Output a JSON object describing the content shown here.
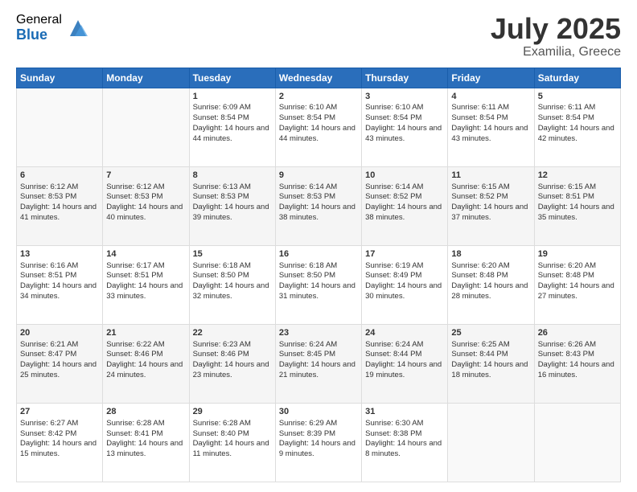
{
  "header": {
    "logo_general": "General",
    "logo_blue": "Blue",
    "month_title": "July 2025",
    "location": "Examilia, Greece"
  },
  "weekdays": [
    "Sunday",
    "Monday",
    "Tuesday",
    "Wednesday",
    "Thursday",
    "Friday",
    "Saturday"
  ],
  "weeks": [
    [
      {
        "day": "",
        "sunrise": "",
        "sunset": "",
        "daylight": ""
      },
      {
        "day": "",
        "sunrise": "",
        "sunset": "",
        "daylight": ""
      },
      {
        "day": "1",
        "sunrise": "Sunrise: 6:09 AM",
        "sunset": "Sunset: 8:54 PM",
        "daylight": "Daylight: 14 hours and 44 minutes."
      },
      {
        "day": "2",
        "sunrise": "Sunrise: 6:10 AM",
        "sunset": "Sunset: 8:54 PM",
        "daylight": "Daylight: 14 hours and 44 minutes."
      },
      {
        "day": "3",
        "sunrise": "Sunrise: 6:10 AM",
        "sunset": "Sunset: 8:54 PM",
        "daylight": "Daylight: 14 hours and 43 minutes."
      },
      {
        "day": "4",
        "sunrise": "Sunrise: 6:11 AM",
        "sunset": "Sunset: 8:54 PM",
        "daylight": "Daylight: 14 hours and 43 minutes."
      },
      {
        "day": "5",
        "sunrise": "Sunrise: 6:11 AM",
        "sunset": "Sunset: 8:54 PM",
        "daylight": "Daylight: 14 hours and 42 minutes."
      }
    ],
    [
      {
        "day": "6",
        "sunrise": "Sunrise: 6:12 AM",
        "sunset": "Sunset: 8:53 PM",
        "daylight": "Daylight: 14 hours and 41 minutes."
      },
      {
        "day": "7",
        "sunrise": "Sunrise: 6:12 AM",
        "sunset": "Sunset: 8:53 PM",
        "daylight": "Daylight: 14 hours and 40 minutes."
      },
      {
        "day": "8",
        "sunrise": "Sunrise: 6:13 AM",
        "sunset": "Sunset: 8:53 PM",
        "daylight": "Daylight: 14 hours and 39 minutes."
      },
      {
        "day": "9",
        "sunrise": "Sunrise: 6:14 AM",
        "sunset": "Sunset: 8:53 PM",
        "daylight": "Daylight: 14 hours and 38 minutes."
      },
      {
        "day": "10",
        "sunrise": "Sunrise: 6:14 AM",
        "sunset": "Sunset: 8:52 PM",
        "daylight": "Daylight: 14 hours and 38 minutes."
      },
      {
        "day": "11",
        "sunrise": "Sunrise: 6:15 AM",
        "sunset": "Sunset: 8:52 PM",
        "daylight": "Daylight: 14 hours and 37 minutes."
      },
      {
        "day": "12",
        "sunrise": "Sunrise: 6:15 AM",
        "sunset": "Sunset: 8:51 PM",
        "daylight": "Daylight: 14 hours and 35 minutes."
      }
    ],
    [
      {
        "day": "13",
        "sunrise": "Sunrise: 6:16 AM",
        "sunset": "Sunset: 8:51 PM",
        "daylight": "Daylight: 14 hours and 34 minutes."
      },
      {
        "day": "14",
        "sunrise": "Sunrise: 6:17 AM",
        "sunset": "Sunset: 8:51 PM",
        "daylight": "Daylight: 14 hours and 33 minutes."
      },
      {
        "day": "15",
        "sunrise": "Sunrise: 6:18 AM",
        "sunset": "Sunset: 8:50 PM",
        "daylight": "Daylight: 14 hours and 32 minutes."
      },
      {
        "day": "16",
        "sunrise": "Sunrise: 6:18 AM",
        "sunset": "Sunset: 8:50 PM",
        "daylight": "Daylight: 14 hours and 31 minutes."
      },
      {
        "day": "17",
        "sunrise": "Sunrise: 6:19 AM",
        "sunset": "Sunset: 8:49 PM",
        "daylight": "Daylight: 14 hours and 30 minutes."
      },
      {
        "day": "18",
        "sunrise": "Sunrise: 6:20 AM",
        "sunset": "Sunset: 8:48 PM",
        "daylight": "Daylight: 14 hours and 28 minutes."
      },
      {
        "day": "19",
        "sunrise": "Sunrise: 6:20 AM",
        "sunset": "Sunset: 8:48 PM",
        "daylight": "Daylight: 14 hours and 27 minutes."
      }
    ],
    [
      {
        "day": "20",
        "sunrise": "Sunrise: 6:21 AM",
        "sunset": "Sunset: 8:47 PM",
        "daylight": "Daylight: 14 hours and 25 minutes."
      },
      {
        "day": "21",
        "sunrise": "Sunrise: 6:22 AM",
        "sunset": "Sunset: 8:46 PM",
        "daylight": "Daylight: 14 hours and 24 minutes."
      },
      {
        "day": "22",
        "sunrise": "Sunrise: 6:23 AM",
        "sunset": "Sunset: 8:46 PM",
        "daylight": "Daylight: 14 hours and 23 minutes."
      },
      {
        "day": "23",
        "sunrise": "Sunrise: 6:24 AM",
        "sunset": "Sunset: 8:45 PM",
        "daylight": "Daylight: 14 hours and 21 minutes."
      },
      {
        "day": "24",
        "sunrise": "Sunrise: 6:24 AM",
        "sunset": "Sunset: 8:44 PM",
        "daylight": "Daylight: 14 hours and 19 minutes."
      },
      {
        "day": "25",
        "sunrise": "Sunrise: 6:25 AM",
        "sunset": "Sunset: 8:44 PM",
        "daylight": "Daylight: 14 hours and 18 minutes."
      },
      {
        "day": "26",
        "sunrise": "Sunrise: 6:26 AM",
        "sunset": "Sunset: 8:43 PM",
        "daylight": "Daylight: 14 hours and 16 minutes."
      }
    ],
    [
      {
        "day": "27",
        "sunrise": "Sunrise: 6:27 AM",
        "sunset": "Sunset: 8:42 PM",
        "daylight": "Daylight: 14 hours and 15 minutes."
      },
      {
        "day": "28",
        "sunrise": "Sunrise: 6:28 AM",
        "sunset": "Sunset: 8:41 PM",
        "daylight": "Daylight: 14 hours and 13 minutes."
      },
      {
        "day": "29",
        "sunrise": "Sunrise: 6:28 AM",
        "sunset": "Sunset: 8:40 PM",
        "daylight": "Daylight: 14 hours and 11 minutes."
      },
      {
        "day": "30",
        "sunrise": "Sunrise: 6:29 AM",
        "sunset": "Sunset: 8:39 PM",
        "daylight": "Daylight: 14 hours and 9 minutes."
      },
      {
        "day": "31",
        "sunrise": "Sunrise: 6:30 AM",
        "sunset": "Sunset: 8:38 PM",
        "daylight": "Daylight: 14 hours and 8 minutes."
      },
      {
        "day": "",
        "sunrise": "",
        "sunset": "",
        "daylight": ""
      },
      {
        "day": "",
        "sunrise": "",
        "sunset": "",
        "daylight": ""
      }
    ]
  ]
}
